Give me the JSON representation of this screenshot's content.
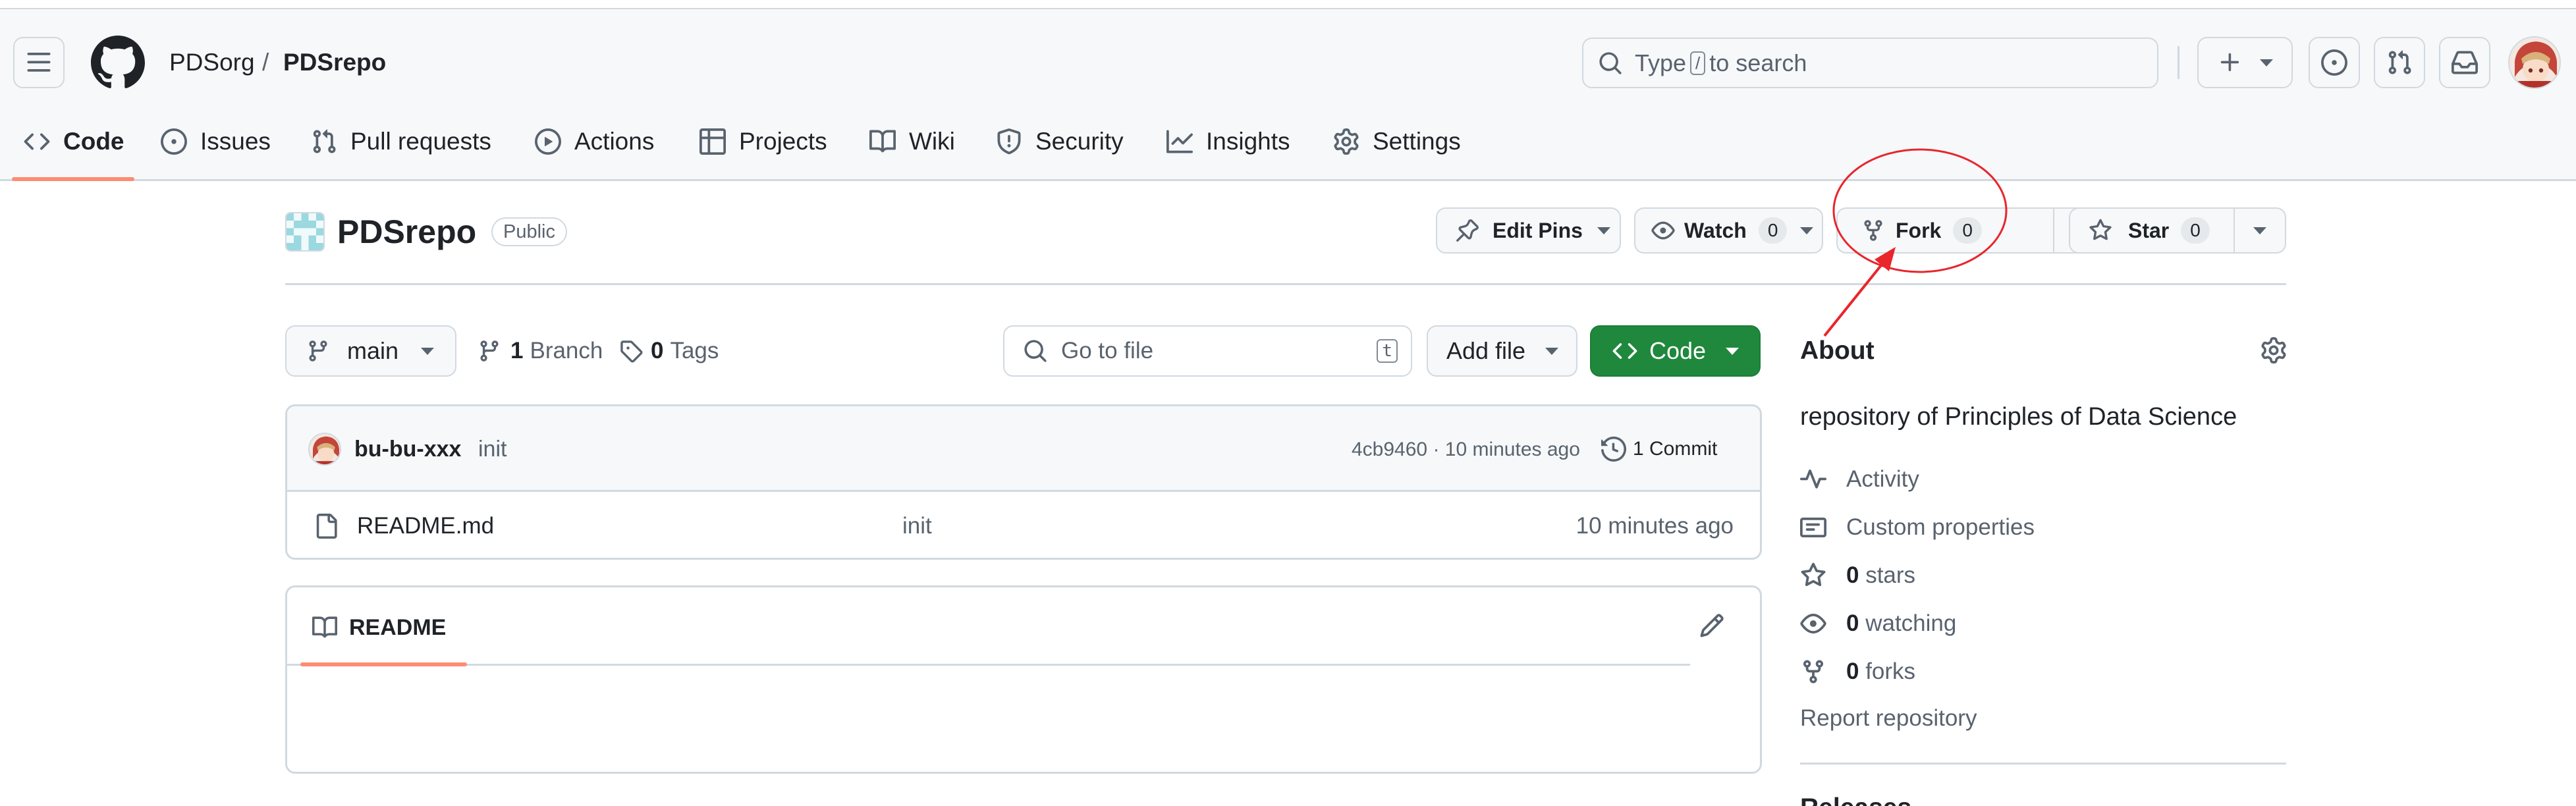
{
  "header": {
    "org": "PDSorg",
    "separator": "/",
    "repo": "PDSrepo",
    "search_prefix": "Type",
    "search_key": "/",
    "search_suffix": "to search"
  },
  "nav": {
    "tabs": [
      {
        "label": "Code",
        "icon": "code-icon",
        "active": true
      },
      {
        "label": "Issues",
        "icon": "issue-opened-icon"
      },
      {
        "label": "Pull requests",
        "icon": "git-pull-request-icon"
      },
      {
        "label": "Actions",
        "icon": "play-icon"
      },
      {
        "label": "Projects",
        "icon": "table-icon"
      },
      {
        "label": "Wiki",
        "icon": "book-icon"
      },
      {
        "label": "Security",
        "icon": "shield-icon"
      },
      {
        "label": "Insights",
        "icon": "graph-icon"
      },
      {
        "label": "Settings",
        "icon": "gear-icon"
      }
    ]
  },
  "repo": {
    "name": "PDSrepo",
    "visibility": "Public",
    "edit_pins_label": "Edit Pins",
    "watch_label": "Watch",
    "watch_count": "0",
    "fork_label": "Fork",
    "fork_count": "0",
    "star_label": "Star",
    "star_count": "0"
  },
  "toolbar": {
    "branch": "main",
    "branches_count": "1",
    "branches_label": "Branch",
    "tags_count": "0",
    "tags_label": "Tags",
    "goto_placeholder": "Go to file",
    "goto_key": "t",
    "add_file_label": "Add file",
    "code_label": "Code"
  },
  "commit": {
    "author": "bu-bu-xxx",
    "message": "init",
    "hash_time": "4cb9460 · 10 minutes ago",
    "commits_label": "1 Commit"
  },
  "files": [
    {
      "name": "README.md",
      "message": "init",
      "time": "10 minutes ago",
      "icon": "file-icon"
    }
  ],
  "readme": {
    "tab_label": "README"
  },
  "about": {
    "title": "About",
    "description": "repository of Principles of Data Science",
    "activity": "Activity",
    "custom_properties": "Custom properties",
    "stars_count": "0",
    "stars_label": "stars",
    "watching_count": "0",
    "watching_label": "watching",
    "forks_count": "0",
    "forks_label": "forks",
    "report": "Report repository",
    "releases": "Releases"
  },
  "colors": {
    "accent_tab": "#fd8c73",
    "primary_green": "#1f883d",
    "annotation_red": "#e8262b",
    "link_blue": "#0969da"
  }
}
